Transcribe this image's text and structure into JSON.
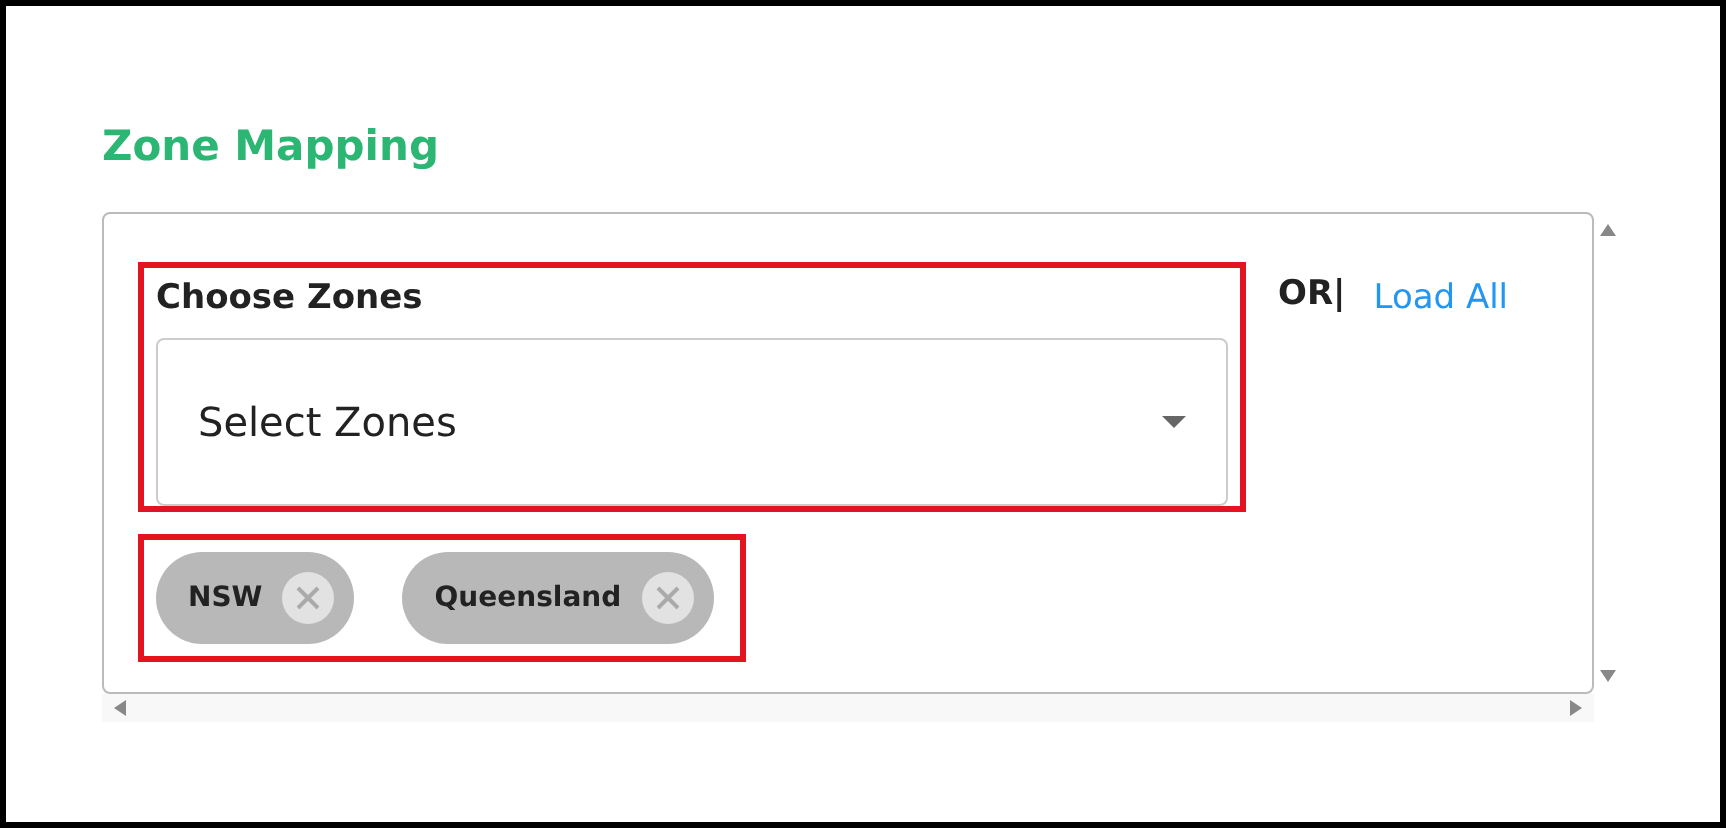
{
  "title": "Zone Mapping",
  "zone_picker": {
    "label": "Choose Zones",
    "placeholder": "Select Zones"
  },
  "separator": "OR|",
  "load_all_link": "Load All",
  "chips": [
    {
      "label": "NSW"
    },
    {
      "label": "Queensland"
    }
  ]
}
